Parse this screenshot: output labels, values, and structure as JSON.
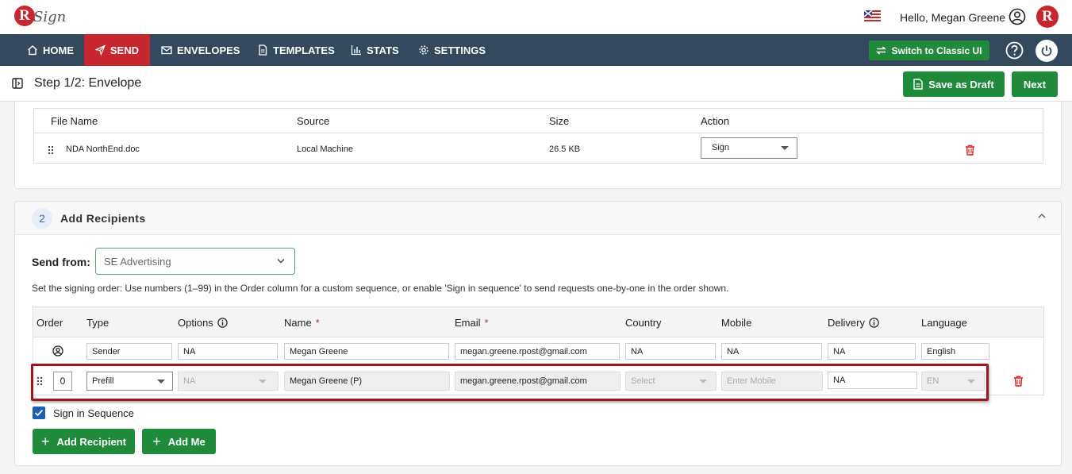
{
  "header": {
    "logo_text": "Sign",
    "greeting": "Hello, Megan Greene",
    "brand_letter": "R"
  },
  "nav": {
    "items": [
      {
        "label": "HOME",
        "icon": "home-icon"
      },
      {
        "label": "SEND",
        "icon": "send-icon",
        "active": true
      },
      {
        "label": "ENVELOPES",
        "icon": "envelope-icon"
      },
      {
        "label": "TEMPLATES",
        "icon": "template-icon"
      },
      {
        "label": "STATS",
        "icon": "stats-icon"
      },
      {
        "label": "SETTINGS",
        "icon": "gear-icon"
      }
    ],
    "classic_label": "Switch to Classic UI"
  },
  "step": {
    "title": "Step 1/2: Envelope",
    "save_draft_label": "Save as Draft",
    "next_label": "Next"
  },
  "files": {
    "headers": [
      "File Name",
      "Source",
      "Size",
      "Action"
    ],
    "rows": [
      {
        "name": "NDA NorthEnd.doc",
        "source": "Local Machine",
        "size": "26.5 KB",
        "action": "Sign"
      }
    ]
  },
  "recipients": {
    "step_number": "2",
    "title": "Add Recipients",
    "send_from_label": "Send from:",
    "send_from_value": "SE Advertising",
    "order_note": "Set the signing order: Use numbers (1–99) in the Order column for a custom sequence, or enable 'Sign in sequence' to send requests one-by-one in the order shown.",
    "headers": {
      "order": "Order",
      "type": "Type",
      "options": "Options",
      "name": "Name",
      "email": "Email",
      "country": "Country",
      "mobile": "Mobile",
      "delivery": "Delivery",
      "language": "Language",
      "required_mark": "*"
    },
    "sender_row": {
      "type": "Sender",
      "options": "NA",
      "name": "Megan Greene",
      "email": "megan.greene.rpost@gmail.com",
      "country": "NA",
      "mobile": "NA",
      "delivery": "NA",
      "language": "English"
    },
    "prefill_row": {
      "order": "0",
      "type": "Prefill",
      "options": "NA",
      "name": "Megan Greene (P)",
      "email": "megan.greene.rpost@gmail.com",
      "country_placeholder": "Select",
      "mobile_placeholder": "Enter Mobile",
      "delivery": "NA",
      "language": "EN"
    },
    "sign_in_sequence_label": "Sign in Sequence",
    "sign_in_sequence_checked": true,
    "add_recipient_label": "Add Recipient",
    "add_me_label": "Add Me"
  },
  "colors": {
    "nav_bg": "#34495e",
    "accent_red": "#c8262e",
    "button_green": "#1f8a3a",
    "highlight": "#a0161c"
  }
}
